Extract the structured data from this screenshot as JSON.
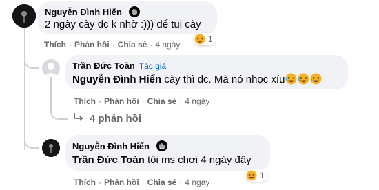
{
  "comments": [
    {
      "author": "Nguyễn Đình Hiển",
      "text": "2 ngày cày dc k nhờ :))) để tui cày",
      "actions": {
        "like": "Thích",
        "reply": "Phản hồi",
        "share": "Chia sẻ",
        "time": "4 ngày"
      },
      "reaction_count": "1",
      "avatar": "avatar-dark",
      "badge_icon": "wave-hand-icon"
    },
    {
      "author": "Trần Đức Toàn",
      "author_tag": "Tác giả",
      "mention": "Nguyễn Đình Hiển",
      "text": "cày thì đc. Mà nó nhọc xíu",
      "actions": {
        "like": "Thích",
        "reply": "Phản hồi",
        "share": "Chia sẻ",
        "time": "4 ngày"
      },
      "avatar": "avatar-default-person"
    },
    {
      "author": "Nguyễn Đình Hiển",
      "mention": "Trần Đức Toàn",
      "text": "tôi ms chơi 4 ngày đây",
      "actions": {
        "like": "Thích",
        "reply": "Phản hồi",
        "share": "Chia sẻ",
        "time": "4 ngày"
      },
      "reaction_count": "1",
      "avatar": "avatar-dark",
      "badge_icon": "wave-hand-icon"
    }
  ],
  "view_replies": "4 phản hồi",
  "colors": {
    "bubble": "#f0f2f5",
    "meta": "#65676b",
    "author_tag": "#0064d1",
    "thread_line": "#ced0d4"
  }
}
